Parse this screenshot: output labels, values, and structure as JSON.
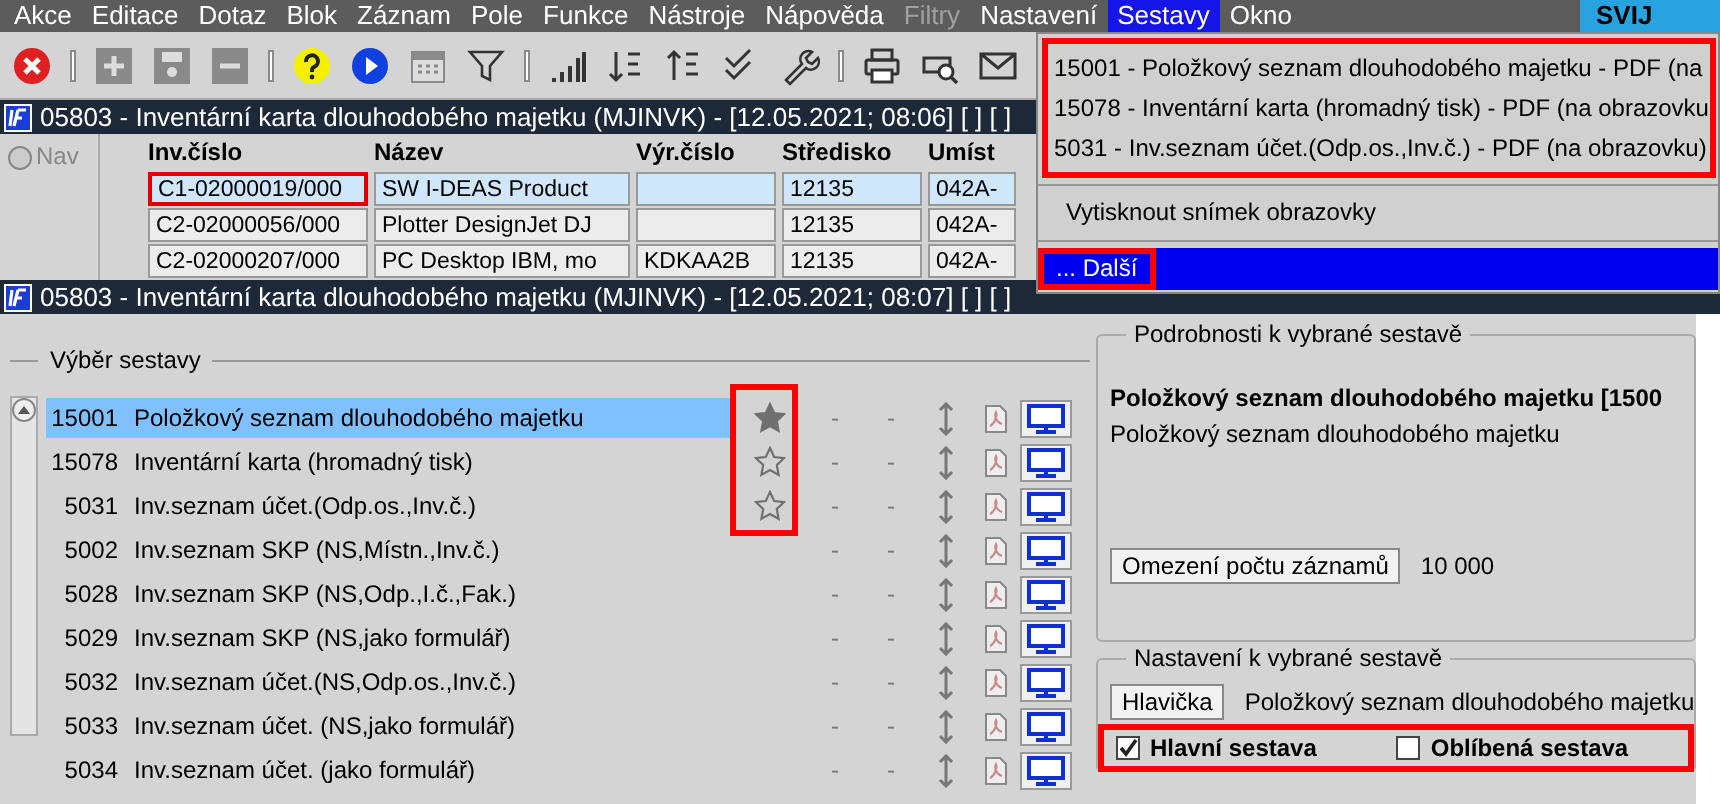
{
  "menu_bar": {
    "items": [
      {
        "label": "Akce",
        "selected": false,
        "disabled": false
      },
      {
        "label": "Editace",
        "selected": false,
        "disabled": false
      },
      {
        "label": "Dotaz",
        "selected": false,
        "disabled": false
      },
      {
        "label": "Blok",
        "selected": false,
        "disabled": false
      },
      {
        "label": "Záznam",
        "selected": false,
        "disabled": false
      },
      {
        "label": "Pole",
        "selected": false,
        "disabled": false
      },
      {
        "label": "Funkce",
        "selected": false,
        "disabled": false
      },
      {
        "label": "Nástroje",
        "selected": false,
        "disabled": false
      },
      {
        "label": "Nápověda",
        "selected": false,
        "disabled": false
      },
      {
        "label": "Filtry",
        "selected": false,
        "disabled": true
      },
      {
        "label": "Nastavení",
        "selected": false,
        "disabled": false
      },
      {
        "label": "Sestavy",
        "selected": true,
        "disabled": false
      },
      {
        "label": "Okno",
        "selected": false,
        "disabled": false
      }
    ],
    "user_badge": "SVIJ"
  },
  "dropdown": {
    "recent_reports": {
      "highlighted": true,
      "items": [
        "15001 - Položkový seznam dlouhodobého majetku - PDF (na",
        "15078 - Inventární karta (hromadný tisk) - PDF (na obrazovku",
        "5031 - Inv.seznam účet.(Odp.os.,Inv.č.) - PDF (na obrazovku)"
      ]
    },
    "items": [
      {
        "label": "Vytisknout snímek obrazovky",
        "selected": false,
        "highlighted": false
      },
      {
        "label": "... Další",
        "selected": true,
        "highlighted": true
      }
    ]
  },
  "back_window": {
    "title": "05803 - Inventární karta dlouhodobého majetku (MJINVK) - [12.05.2021; 08:06]  [ ]  [ ]",
    "nav_label": "Nav",
    "nav_selected": false,
    "table": {
      "columns": [
        "Inv.číslo",
        "Název",
        "Výr.číslo",
        "Středisko",
        "Umíst"
      ],
      "rows": [
        {
          "selected": true,
          "cells": [
            "C1-02000019/000",
            "SW I-DEAS Product",
            "",
            "12135",
            "042A-"
          ]
        },
        {
          "selected": false,
          "cells": [
            "C2-02000056/000",
            "Plotter DesignJet DJ",
            "",
            "12135",
            "042A-"
          ]
        },
        {
          "selected": false,
          "cells": [
            "C2-02000207/000",
            "PC Desktop IBM, mo",
            "KDKAA2B",
            "12135",
            "042A-"
          ]
        }
      ]
    }
  },
  "front_window": {
    "title": "05803 - Inventární karta dlouhodobého majetku (MJINVK) - [12.05.2021; 08:07]  [ ]  [ ]",
    "report_list": {
      "title": "Výběr sestavy",
      "favorites_highlighted": true,
      "rows": [
        {
          "number": "15001",
          "name": "Položkový seznam dlouhodobého majetku",
          "selected": true,
          "favorite": true,
          "flags": [
            "-",
            "-"
          ]
        },
        {
          "number": "15078",
          "name": "Inventární karta (hromadný tisk)",
          "selected": false,
          "favorite": false,
          "flags": [
            "-",
            "-"
          ]
        },
        {
          "number": "5031",
          "name": "Inv.seznam účet.(Odp.os.,Inv.č.)",
          "selected": false,
          "favorite": false,
          "flags": [
            "-",
            "-"
          ]
        },
        {
          "number": "5002",
          "name": "Inv.seznam SKP (NS,Místn.,Inv.č.)",
          "selected": false,
          "flags": [
            "-",
            "-"
          ]
        },
        {
          "number": "5028",
          "name": "Inv.seznam SKP (NS,Odp.,I.č.,Fak.)",
          "selected": false,
          "flags": [
            "-",
            "-"
          ]
        },
        {
          "number": "5029",
          "name": "Inv.seznam SKP (NS,jako formulář)",
          "selected": false,
          "flags": [
            "-",
            "-"
          ]
        },
        {
          "number": "5032",
          "name": "Inv.seznam účet.(NS,Odp.os.,Inv.č.)",
          "selected": false,
          "flags": [
            "-",
            "-"
          ]
        },
        {
          "number": "5033",
          "name": "Inv.seznam účet. (NS,jako formulář)",
          "selected": false,
          "flags": [
            "-",
            "-"
          ]
        },
        {
          "number": "5034",
          "name": "Inv.seznam účet. (jako formulář)",
          "selected": false,
          "flags": [
            "-",
            "-"
          ]
        }
      ]
    },
    "details": {
      "title": "Podrobnosti k vybrané sestavě",
      "heading": "Položkový seznam dlouhodobého majetku [1500",
      "description": "Položkový seznam dlouhodobého majetku",
      "limit_button": "Omezení počtu záznamů",
      "limit_value": "10 000"
    },
    "settings": {
      "title": "Nastavení k vybrané sestavě",
      "header_button": "Hlavička",
      "header_text": "Položkový seznam dlouhodobého majetku",
      "highlighted": true,
      "checkboxes": [
        {
          "label": "Hlavní sestava",
          "checked": true
        },
        {
          "label": "Oblíbená sestava",
          "checked": false
        }
      ]
    }
  }
}
